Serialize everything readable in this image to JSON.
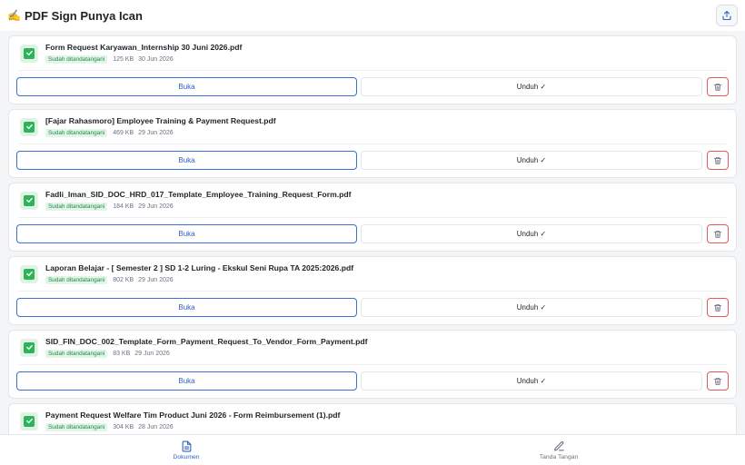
{
  "header": {
    "logo_glyph": "✍️",
    "title": "PDF Sign Punya Ican"
  },
  "documents": [
    {
      "name": "Form Request Karyawan_Internship 30 Juni 2026.pdf",
      "status": "Sudah ditandatangani",
      "size": "125 KB",
      "date": "30 Jun 2026"
    },
    {
      "name": "[Fajar Rahasmoro] Employee Training & Payment Request.pdf",
      "status": "Sudah ditandatangani",
      "size": "469 KB",
      "date": "29 Jun 2026"
    },
    {
      "name": "Fadli_Iman_SID_DOC_HRD_017_Template_Employee_Training_Request_Form.pdf",
      "status": "Sudah ditandatangani",
      "size": "184 KB",
      "date": "29 Jun 2026"
    },
    {
      "name": "Laporan Belajar - [ Semester 2 ] SD 1-2 Luring - Ekskul Seni Rupa TA 2025:2026.pdf",
      "status": "Sudah ditandatangani",
      "size": "802 KB",
      "date": "29 Jun 2026"
    },
    {
      "name": "SID_FIN_DOC_002_Template_Form_Payment_Request_To_Vendor_Form_Payment.pdf",
      "status": "Sudah ditandatangani",
      "size": "83 KB",
      "date": "29 Jun 2026"
    },
    {
      "name": "Payment Request Welfare Tim Product Juni 2026 - Form Reimbursement (1).pdf",
      "status": "Sudah ditandatangani",
      "size": "304 KB",
      "date": "28 Jun 2026"
    }
  ],
  "actions": {
    "open_label": "Buka",
    "download_label": "Unduh ✓"
  },
  "nav": {
    "documents_label": "Dokumen",
    "signature_label": "Tanda Tangan"
  },
  "colors": {
    "accent": "#2f5fc7",
    "success": "#2fb25a",
    "danger": "#e35a5a"
  },
  "icons": [
    "upload-icon",
    "check-icon",
    "trash-icon",
    "document-icon",
    "pen-icon"
  ]
}
